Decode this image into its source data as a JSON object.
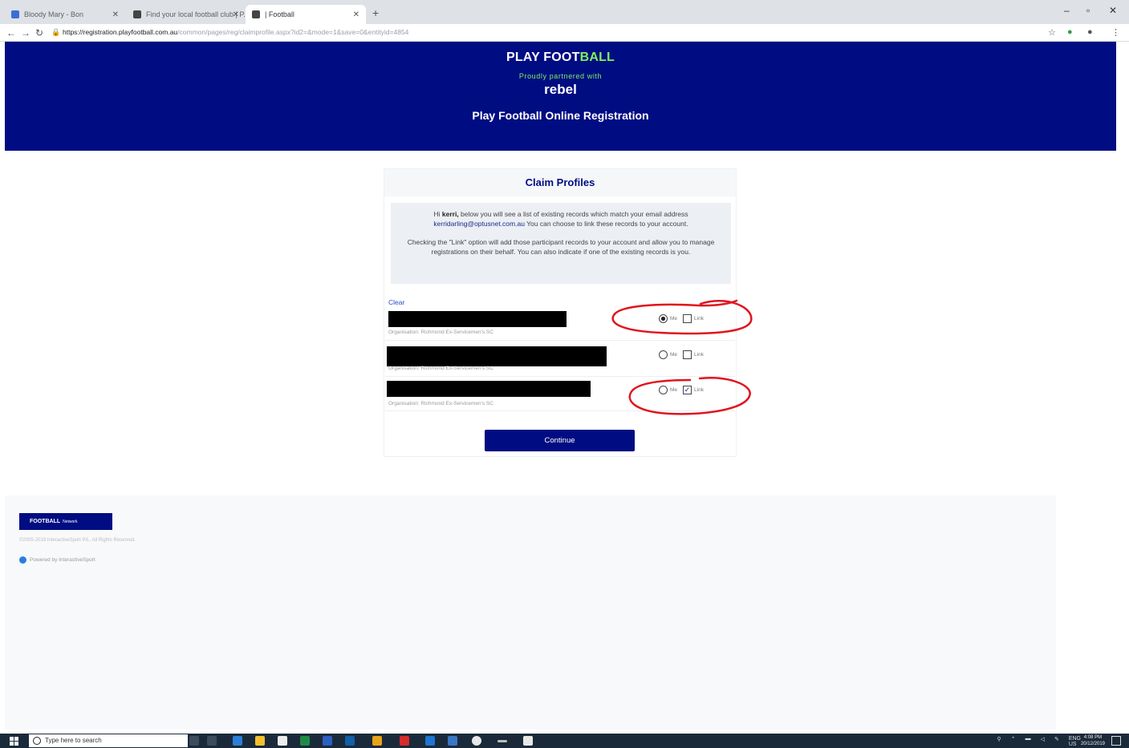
{
  "browser": {
    "tabs": [
      {
        "label": "Bloody Mary - Bon"
      },
      {
        "label": "Find your local football club | P..."
      },
      {
        "label": "| Football"
      }
    ],
    "url_host": "https://registration.playfootball.com.au",
    "url_path": "/common/pages/reg/claimprofile.aspx?id2=&mode=1&save=0&entityid=4854"
  },
  "header": {
    "brand_a": "PLAY FOOT",
    "brand_b": "BALL",
    "partner": "Proudly partnered with",
    "sponsor": "rebel",
    "title": "Play Football Online Registration"
  },
  "card": {
    "title": "Claim Profiles",
    "info_hi": "Hi ",
    "info_name": "kerri,",
    "info_line1": " below you will see a list of existing records which match your email address",
    "info_email": "kerridarling@optusnet.com.au",
    "info_line2": " You can choose to link these records to your account.",
    "info_para2": "Checking the \"Link\" option will add those participant records to your account and allow you to manage registrations on their behalf. You can also indicate if one of the existing records is you.",
    "clear_label": "Clear",
    "records": [
      {
        "org": "Organisation: Richmond Ex-Servicemen's SC",
        "me_label": "Me",
        "link_label": "Link",
        "me_selected": true,
        "link_checked": false
      },
      {
        "org": "Organisation: Richmond Ex-Servicemen's SC",
        "me_label": "Me",
        "link_label": "Link",
        "me_selected": false,
        "link_checked": false
      },
      {
        "org": "Organisation: Richmond Ex-Servicemen's SC",
        "me_label": "Me",
        "link_label": "Link",
        "me_selected": false,
        "link_checked": true
      }
    ],
    "continue_label": "Continue"
  },
  "footer": {
    "network_a": "FOOTBALL",
    "network_b": "Network",
    "copyright": "©2005-2019 InteractiveSport P/L. All Rights Reserved.",
    "powered": "Powered by InteractiveSport"
  },
  "taskbar": {
    "search_placeholder": "Type here to search",
    "lang_a": "ENG",
    "lang_b": "US",
    "time": "4:08 PM",
    "date": "20/12/2019"
  },
  "colors": {
    "brand_navy": "#000c82",
    "brand_green": "#7ef25c",
    "annotation_red": "#e0141e"
  }
}
